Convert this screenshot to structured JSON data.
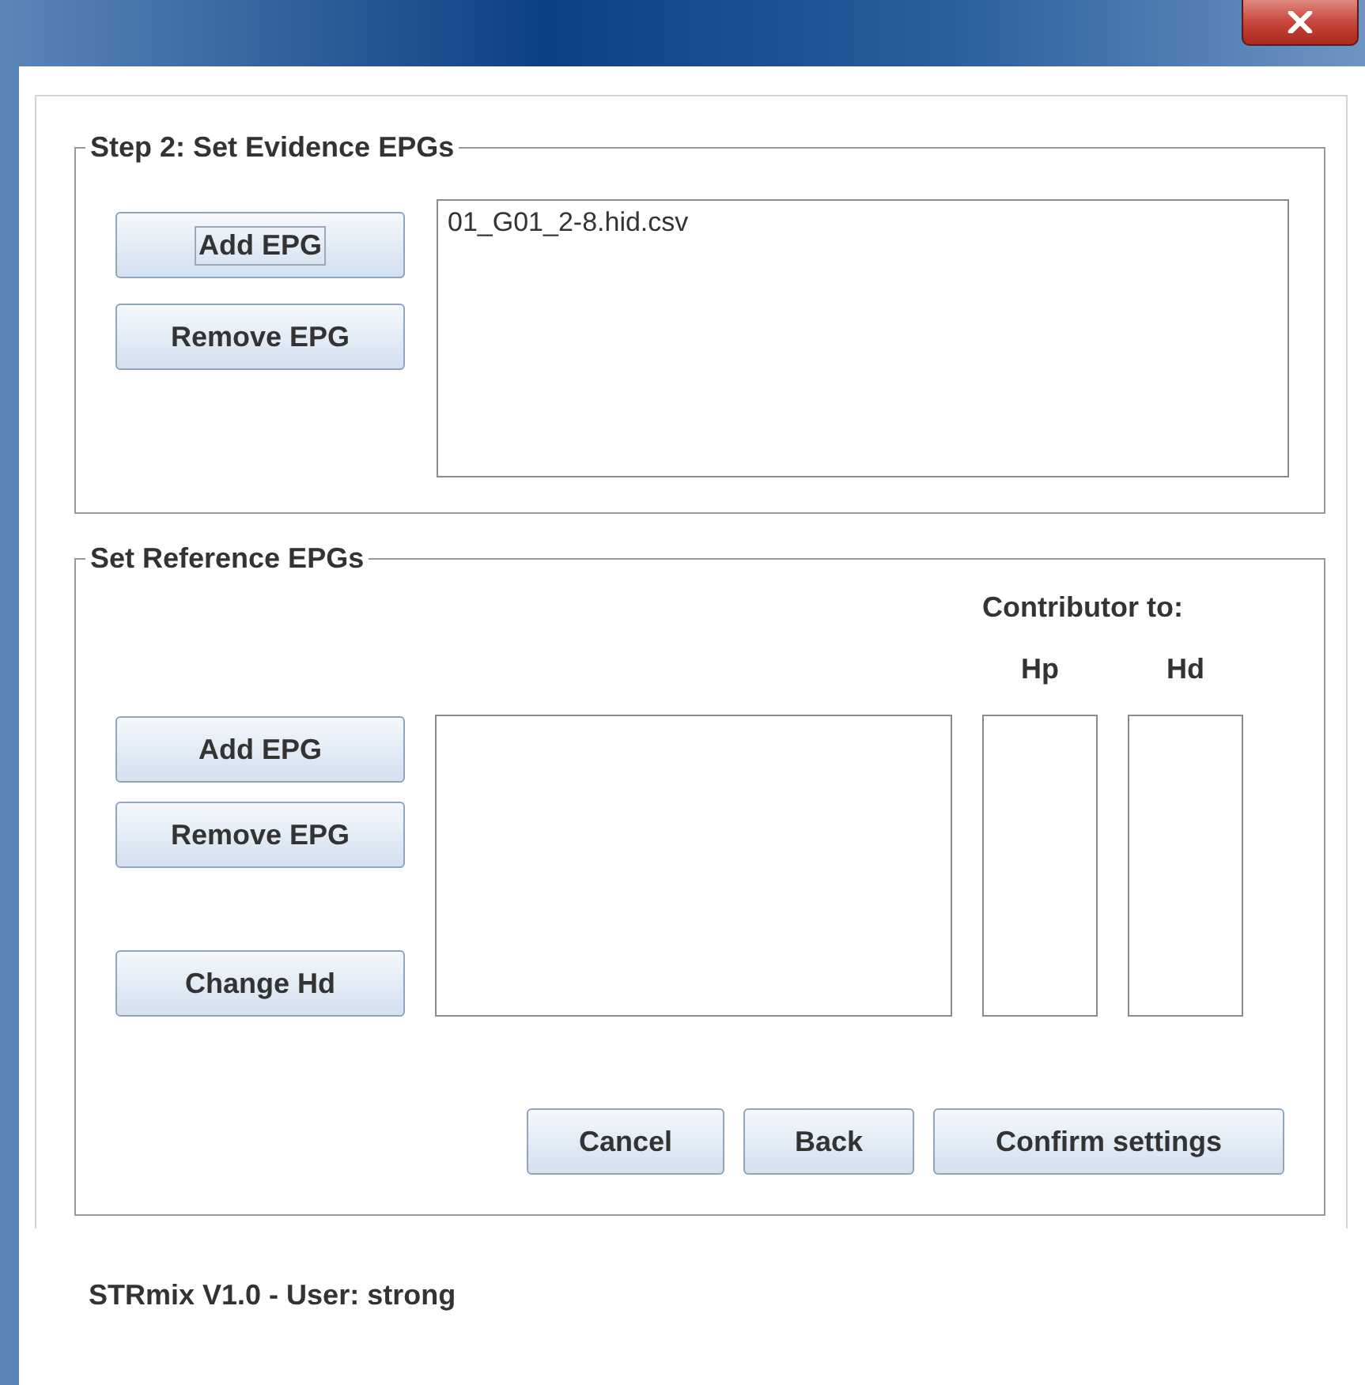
{
  "evidence": {
    "title": "Step 2: Set Evidence EPGs",
    "buttons": [
      {
        "label": "Add EPG",
        "focused": true
      },
      {
        "label": "Remove EPG",
        "focused": false
      }
    ],
    "files": [
      "01_G01_2-8.hid.csv"
    ]
  },
  "reference": {
    "title": "Set Reference EPGs",
    "contributor_heading": "Contributor to:",
    "columns": [
      "Hp",
      "Hd"
    ],
    "buttons": [
      {
        "label": "Add EPG",
        "focused": false
      },
      {
        "label": "Remove EPG",
        "focused": false
      },
      {
        "label": "Change Hd",
        "focused": false
      }
    ],
    "actions": [
      "Cancel",
      "Back",
      "Confirm settings"
    ]
  },
  "status_bar": "STRmix V1.0 - User: strong"
}
